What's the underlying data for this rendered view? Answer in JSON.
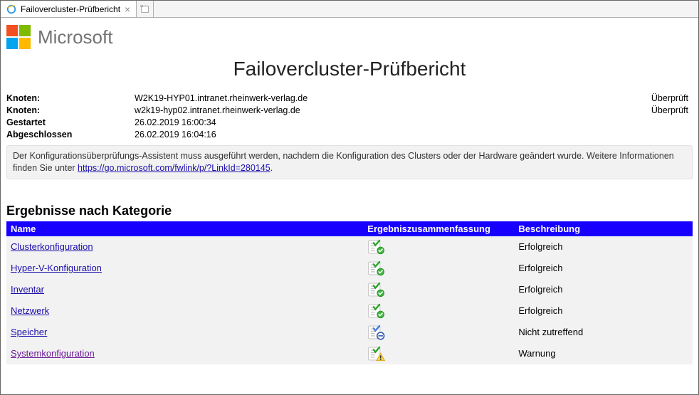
{
  "tab": {
    "title": "Failovercluster-Prüfbericht"
  },
  "brand": {
    "name": "Microsoft"
  },
  "report": {
    "title": "Failovercluster-Prüfbericht"
  },
  "info": {
    "nodeLabel": "Knoten:",
    "nodes": [
      {
        "host": "W2K19-HYP01.intranet.rheinwerk-verlag.de",
        "status": "Überprüft"
      },
      {
        "host": "w2k19-hyp02.intranet.rheinwerk-verlag.de",
        "status": "Überprüft"
      }
    ],
    "startedLabel": "Gestartet",
    "startedValue": "26.02.2019 16:00:34",
    "completedLabel": "Abgeschlossen",
    "completedValue": "26.02.2019 16:04:16"
  },
  "notice": {
    "textBefore": "Der Konfigurationsüberprüfungs-Assistent muss ausgeführt werden, nachdem die Konfiguration des Clusters oder der Hardware geändert wurde. Weitere Informationen finden Sie unter ",
    "link": "https://go.microsoft.com/fwlink/p/?LinkId=280145",
    "textAfter": "."
  },
  "results": {
    "heading": "Ergebnisse nach Kategorie",
    "columns": {
      "name": "Name",
      "summary": "Ergebniszusammenfassung",
      "description": "Beschreibung"
    },
    "rows": [
      {
        "name": "Clusterkonfiguration",
        "status": "success",
        "description": "Erfolgreich"
      },
      {
        "name": "Hyper-V-Konfiguration",
        "status": "success",
        "description": "Erfolgreich"
      },
      {
        "name": "Inventar",
        "status": "success",
        "description": "Erfolgreich"
      },
      {
        "name": "Netzwerk",
        "status": "success",
        "description": "Erfolgreich"
      },
      {
        "name": "Speicher",
        "status": "na",
        "description": "Nicht zutreffend"
      },
      {
        "name": "Systemkonfiguration",
        "status": "warning",
        "description": "Warnung",
        "visited": true
      }
    ]
  }
}
